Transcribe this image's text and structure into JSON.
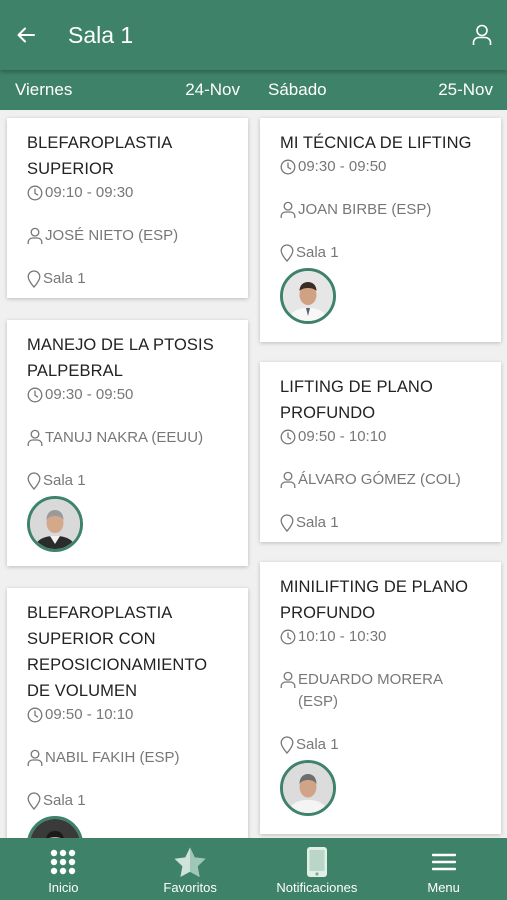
{
  "header": {
    "title": "Sala 1",
    "back_icon": "arrow-left-icon",
    "user_icon": "user-icon"
  },
  "days": [
    {
      "name": "Viernes",
      "date": "24-Nov"
    },
    {
      "name": "Sábado",
      "date": "25-Nov"
    }
  ],
  "columns": [
    {
      "sessions": [
        {
          "title": "BLEFAROPLASTIA SUPERIOR",
          "time": "09:10 - 09:30",
          "speaker": "JOSÉ NIETO (ESP)",
          "room": "Sala 1",
          "has_avatar": false
        },
        {
          "title": "MANEJO DE LA PTOSIS PALPEBRAL",
          "time": "09:30 - 09:50",
          "speaker": "TANUJ NAKRA (EEUU)",
          "room": "Sala 1",
          "has_avatar": true
        },
        {
          "title": "BLEFAROPLASTIA SUPERIOR CON REPOSICIONAMIENTO DE VOLUMEN",
          "time": "09:50 - 10:10",
          "speaker": "NABIL FAKIH (ESP)",
          "room": "Sala 1",
          "has_avatar": true
        }
      ]
    },
    {
      "sessions": [
        {
          "title": "MI TÉCNICA DE LIFTING",
          "time": "09:30 - 09:50",
          "speaker": "JOAN BIRBE (ESP)",
          "room": "Sala 1",
          "has_avatar": true
        },
        {
          "title": "LIFTING DE PLANO PROFUNDO",
          "time": "09:50 - 10:10",
          "speaker": "ÁLVARO GÓMEZ (COL)",
          "room": "Sala 1",
          "has_avatar": false
        },
        {
          "title": "MINILIFTING DE PLANO PROFUNDO",
          "time": "10:10 - 10:30",
          "speaker": "EDUARDO MORERA (ESP)",
          "room": "Sala 1",
          "has_avatar": true
        }
      ]
    }
  ],
  "tabbar": [
    {
      "label": "Inicio",
      "icon": "grid-icon"
    },
    {
      "label": "Favoritos",
      "icon": "star-icon"
    },
    {
      "label": "Notificaciones",
      "icon": "phone-icon"
    },
    {
      "label": "Menu",
      "icon": "menu-icon"
    }
  ],
  "colors": {
    "primary": "#3e826a",
    "background": "#f0f0f0",
    "card": "#ffffff",
    "meta_text": "#777777"
  }
}
